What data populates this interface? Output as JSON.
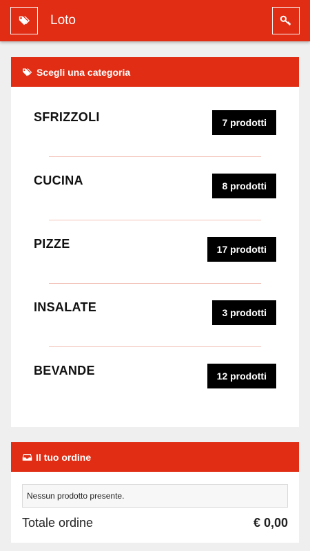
{
  "header": {
    "title": "Loto",
    "left_icon": "tags-icon",
    "right_icon": "key-icon",
    "color": "#e02d14"
  },
  "categories_panel": {
    "title": "Scegli una categoria",
    "icon": "tags-icon",
    "items": [
      {
        "name": "SFRIZZOLI",
        "count": "7 prodotti"
      },
      {
        "name": "CUCINA",
        "count": "8 prodotti"
      },
      {
        "name": "PIZZE",
        "count": "17 prodotti"
      },
      {
        "name": "INSALATE",
        "count": "3 prodotti"
      },
      {
        "name": "BEVANDE",
        "count": "12 prodotti"
      }
    ]
  },
  "order_panel": {
    "title": "Il tuo ordine",
    "icon": "inbox-icon",
    "empty_message": "Nessun prodotto presente.",
    "total_label": "Totale ordine",
    "total_value": "€ 0,00"
  }
}
